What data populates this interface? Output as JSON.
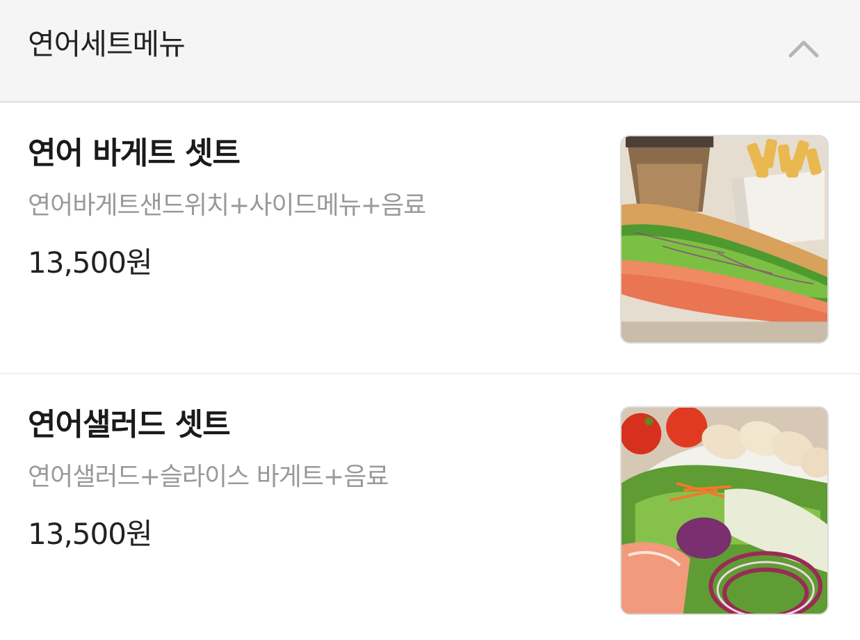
{
  "section": {
    "title": "연어세트메뉴",
    "toggle_icon": "chevron-up-icon",
    "expanded": true
  },
  "items": [
    {
      "name": "연어 바게트 셋트",
      "description": "연어바게트샌드위치+사이드메뉴+음료",
      "price": "13,500원",
      "image_icon": "salmon-baguette-photo"
    },
    {
      "name": "연어샐러드 셋트",
      "description": "연어샐러드+슬라이스 바게트+음료",
      "price": "13,500원",
      "image_icon": "salmon-salad-photo"
    }
  ],
  "colors": {
    "header_bg": "#f5f5f5",
    "description": "#999999",
    "chevron": "#b5b5b5"
  }
}
